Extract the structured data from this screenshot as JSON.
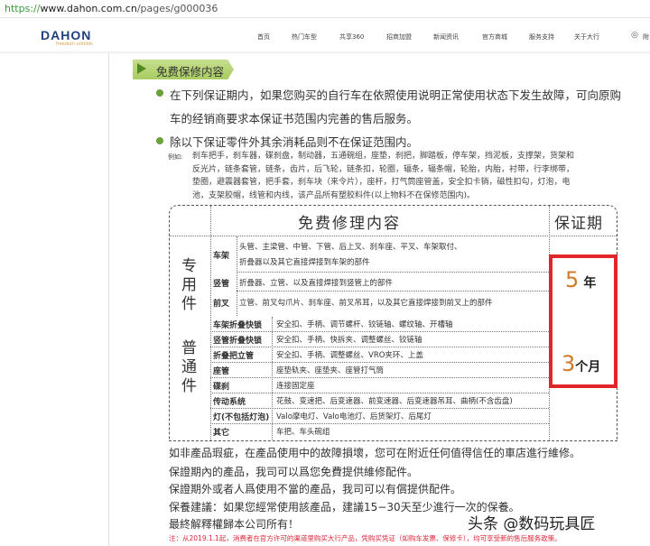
{
  "browser": {
    "url_proto": "https://",
    "url_host": "www.dahon.com.cn",
    "url_path": "/pages/g000036"
  },
  "header": {
    "logo": "DAHON",
    "logo_tagline": "freedom unfolds",
    "nav": [
      "首页",
      "热门车型",
      "共享360",
      "招商加盟",
      "新闻资讯",
      "官方商城",
      "服务支持",
      "关于大行"
    ],
    "location_label": "附"
  },
  "section": {
    "title": "免费保修内容",
    "bullets": [
      "在下列保证期内，如果您购买的自行车在依照使用说明正常使用状态下发生故障，可向原购",
      "车的经销商要求本保证书范围内完善的售后服务。",
      "除以下保证零件外其余消耗品则不在保证范围内。"
    ],
    "example_label": "例如:",
    "example_lines": [
      "刹车把手，刹车器，碟刹盘，制动器，五通碗组，座垫，刹把，脚踏板，停车架，挡泥板，支撑架，货架和",
      "反光片，链条套管，链条，齿片，后飞轮，链条扣，轮圈，辐条，辐条帽，轮胎，内胎，衬带，行李绑带，",
      "垫圈，避震器套管，把手套，刹车块（来令片），座杆，打气筒座管盖，安全扣卡销，磁性扣勾，灯泡，电",
      "池，支架胶帽，线管和内线，该产品所有塑胶料件(以上物料不在保修范围内)。"
    ]
  },
  "table": {
    "header_content": "免费修理内容",
    "header_period": "保证期",
    "group1": "专用件",
    "group2": "普通件",
    "special": [
      {
        "label": "车架",
        "lines": [
          "头管、主梁管、中管、下管、后上叉、刹车座、平叉、车架取付、",
          "折叠器以及其它直接焊接到车架的部件"
        ]
      },
      {
        "label": "竖管",
        "lines": [
          "折叠器、立管、以及直接焊接到竖管上的部件"
        ]
      },
      {
        "label": "前叉",
        "lines": [
          "立管、前叉勾爪片、刹车座、前叉吊耳，以及其它直接焊接到前叉上的部件"
        ]
      }
    ],
    "common": [
      {
        "label": "车架折叠快锁",
        "text": "安全扣、手柄、调节螺杆、铰链轴、螺纹轴、开槽轴"
      },
      {
        "label": "竖管折叠快锁",
        "text": "安全扣、手柄、快拆夹、调整螺丝、铰链轴"
      },
      {
        "label": "折叠把立管",
        "text": "安全扣、手柄、调整螺丝、VRO夹环、上盖"
      },
      {
        "label": "座管",
        "text": "座垫轨夹、座垫夹、座管打气筒"
      },
      {
        "label": "碟刹",
        "text": "连接固定座"
      },
      {
        "label": "传动系统",
        "text": "花鼓、变速把、后变速器、前变速器、后变速器吊耳、曲柄(不含齿盘)"
      },
      {
        "label": "灯(不包括灯泡)",
        "text": "Valo摩电灯、Valo电池灯、后货架灯、后尾灯"
      },
      {
        "label": "其它",
        "text": "车把、车头碗组"
      }
    ],
    "period1_num": "5",
    "period1_unit": "年",
    "period2_num": "3",
    "period2_unit": "个月"
  },
  "footer": {
    "lines": [
      "如非產品瑕疵，在產品使用中的故障損壞，您可在附近任何值得信任的車店進行維修。",
      "保證期內的產品，我司可以爲您免費提供維修配件。",
      "保證期外或者人爲使用不當的產品，我司可以有償提供配件。",
      "保養建議：如果您經常使用該產品，建議15−30天至少進行一次的保養。",
      "最終解釋權歸本公司所有！"
    ],
    "note": "注：从2019.1.1起，消费者在官方许可的渠道里购买大行产品，凭购买凭证（如购车发票、保修卡），均可享受新的售后服务政策。"
  },
  "watermark": "头条 @数码玩具匠"
}
